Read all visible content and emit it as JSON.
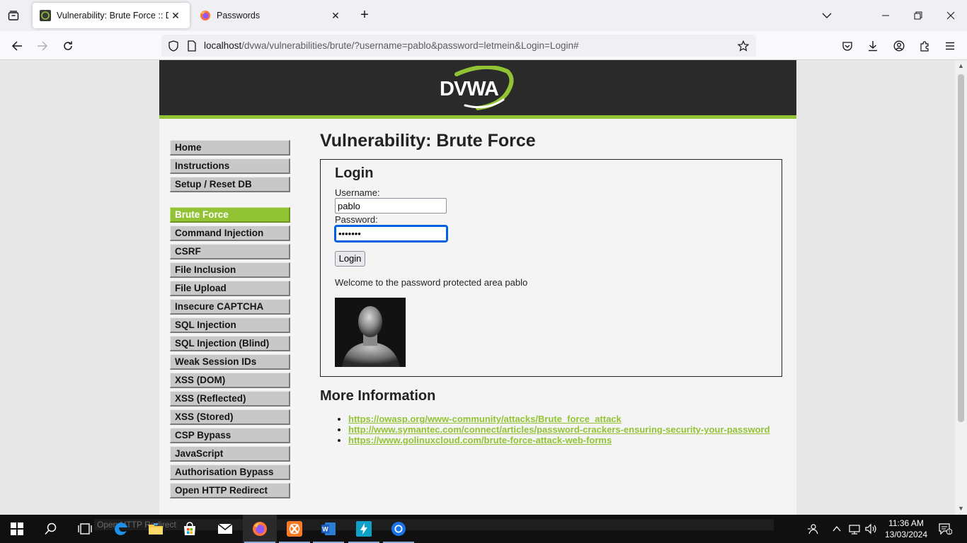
{
  "browser": {
    "tabs": [
      {
        "title": "Vulnerability: Brute Force :: Damn Vulnerable Web Application (DVWA)",
        "active": true
      },
      {
        "title": "Passwords",
        "active": false
      }
    ],
    "url": {
      "host": "localhost",
      "path": "/dvwa/vulnerabilities/brute/?username=pablo&password=letmein&Login=Login#"
    }
  },
  "header": {
    "logo_text": "DVWA"
  },
  "menu": {
    "group1": [
      "Home",
      "Instructions",
      "Setup / Reset DB"
    ],
    "group2": [
      "Brute Force",
      "Command Injection",
      "CSRF",
      "File Inclusion",
      "File Upload",
      "Insecure CAPTCHA",
      "SQL Injection",
      "SQL Injection (Blind)",
      "Weak Session IDs",
      "XSS (DOM)",
      "XSS (Reflected)",
      "XSS (Stored)",
      "CSP Bypass",
      "JavaScript",
      "Authorisation Bypass",
      "Open HTTP Redirect"
    ],
    "selected": "Brute Force"
  },
  "main": {
    "title": "Vulnerability: Brute Force",
    "login": {
      "heading": "Login",
      "username_label": "Username:",
      "username_value": "pablo",
      "password_label": "Password:",
      "password_value": "letmein",
      "button": "Login"
    },
    "welcome": "Welcome to the password protected area pablo",
    "more_info_heading": "More Information",
    "links": [
      "https://owasp.org/www-community/attacks/Brute_force_attack",
      "http://www.symantec.com/connect/articles/password-crackers-ensuring-security-your-password",
      "https://www.golinuxcloud.com/brute-force-attack-web-forms"
    ]
  },
  "taskbar": {
    "ghost_text": "Open HTTP Redirect",
    "time": "11:36 AM",
    "date": "13/03/2024",
    "notifications": "1"
  },
  "colors": {
    "accent": "#92c334",
    "header": "#2a2a2a",
    "focus": "#0060df"
  }
}
